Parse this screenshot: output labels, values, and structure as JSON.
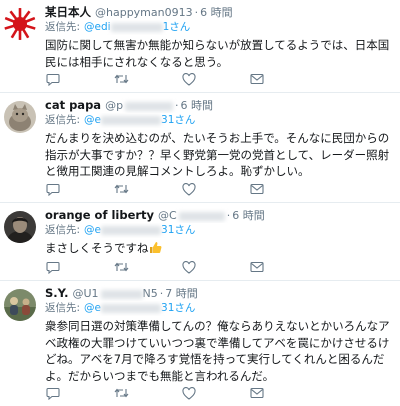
{
  "tweets": [
    {
      "name": "某日本人",
      "handle": "@happyman0913",
      "time": "6 時間",
      "reply_prefix": "返信先:",
      "mention": "@edi",
      "mention_tail": "1さん",
      "text": "国防に関して無害か無能か知らないが放置してるようでは、日本国民には相手にされなくなると思う。"
    },
    {
      "name": "cat papa",
      "handle": "@p",
      "time": "6 時間",
      "reply_prefix": "返信先:",
      "mention": "@e",
      "mention_tail": "31さん",
      "text": "だんまりを決め込むのが、たいそうお上手で。そんなに民団からの指示が大事ですか？？早く野党第一党の党首として、レーダー照射と徴用工関連の見解コメントしろよ。恥ずかしい。"
    },
    {
      "name": "orange of liberty",
      "handle": "@C",
      "time": "6 時間",
      "reply_prefix": "返信先:",
      "mention": "@e",
      "mention_tail": "31さん",
      "text": "まさしくそうですね"
    },
    {
      "name": "S.Y.",
      "handle": "@U1",
      "handle_tail": "N5",
      "time": "7 時間",
      "reply_prefix": "返信先:",
      "mention": "@e",
      "mention_tail": "31さん",
      "text": "衆参同日選の対策準備してんの？俺ならありえないとかいろんなアベ政権の大罪つけていいつつ裏で準備してアベを罠にかけさせるけどね。アベを7月で降ろす覚悟を持って実行してくれんと困るんだよ。だからいつまでも無能と言われるんだ。"
    }
  ],
  "icons": [
    "reply-icon",
    "retweet-icon",
    "like-icon",
    "dm-icon"
  ],
  "colors": {
    "link": "#1da1f2",
    "muted": "#657786",
    "text": "#14171a",
    "border": "#e6ecf0"
  }
}
